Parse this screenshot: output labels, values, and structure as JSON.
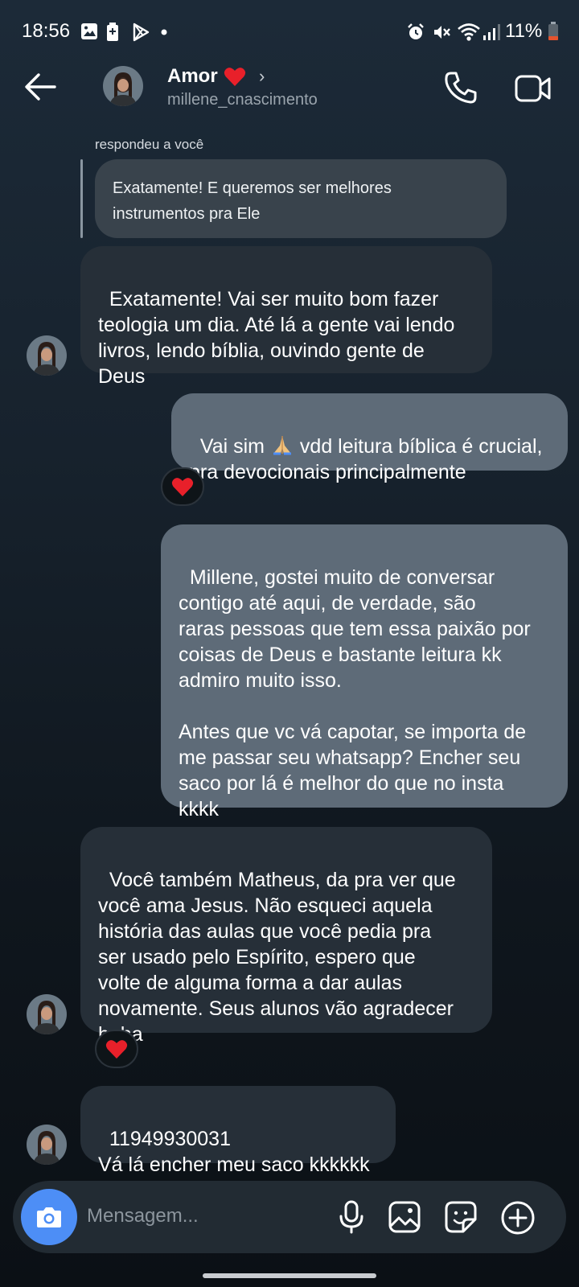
{
  "status_bar": {
    "time": "18:56",
    "battery": "11%",
    "icons": [
      "gallery-icon",
      "battery-saver-icon",
      "play-store-icon",
      "dot-icon",
      "alarm-icon",
      "mute-icon",
      "wifi-icon",
      "signal-icon",
      "battery-icon"
    ]
  },
  "header": {
    "name": "Amor",
    "name_emoji": "heart",
    "handle": "millene_cnascimento",
    "icons": [
      "back-arrow-icon",
      "chevron-right-icon",
      "phone-icon",
      "video-camera-icon"
    ]
  },
  "thread": {
    "reply_note": "respondeu a você",
    "quoted_text": "Exatamente! E queremos ser melhores\ninstrumentos pra Ele",
    "messages": [
      {
        "side": "in",
        "text": "Exatamente! Vai ser muito bom fazer\nteologia um dia. Até lá a gente vai lendo\nlivros, lendo bíblia, ouvindo gente de\nDeus"
      },
      {
        "side": "out",
        "text_before": "Vai sim ",
        "emoji": "folded-hands",
        "text_after": " vdd leitura bíblica é crucial,\npra devocionais principalmente",
        "reaction": "heart"
      },
      {
        "side": "out",
        "text": "Millene, gostei muito de conversar\ncontigo até aqui, de verdade, são\nraras pessoas que tem essa paixão por\ncoisas de Deus e bastante leitura kk\nadmiro muito isso.\n\nAntes que vc vá capotar, se importa de\nme passar seu whatsapp? Encher seu\nsaco por lá é melhor do que no insta\nkkkk"
      },
      {
        "side": "in",
        "text": "Você também Matheus, da pra ver que\nvocê ama Jesus. Não esqueci aquela\nhistória das aulas que você pedia pra\nser usado pelo Espírito, espero que\nvolte de alguma forma a dar aulas\nnovamente. Seus alunos vão agradecer\nhaha",
        "reaction": "heart"
      },
      {
        "side": "in",
        "text": "11949930031\nVá lá encher meu saco kkkkkk"
      }
    ]
  },
  "composer": {
    "placeholder": "Mensagem...",
    "icons": [
      "camera-icon",
      "microphone-icon",
      "gallery-icon",
      "sticker-icon",
      "plus-icon"
    ]
  },
  "colors": {
    "incoming_bubble": "#262f38",
    "outgoing_bubble": "#5e6b78",
    "camera_button": "#4d8ef6",
    "heart": "#e8202a"
  }
}
